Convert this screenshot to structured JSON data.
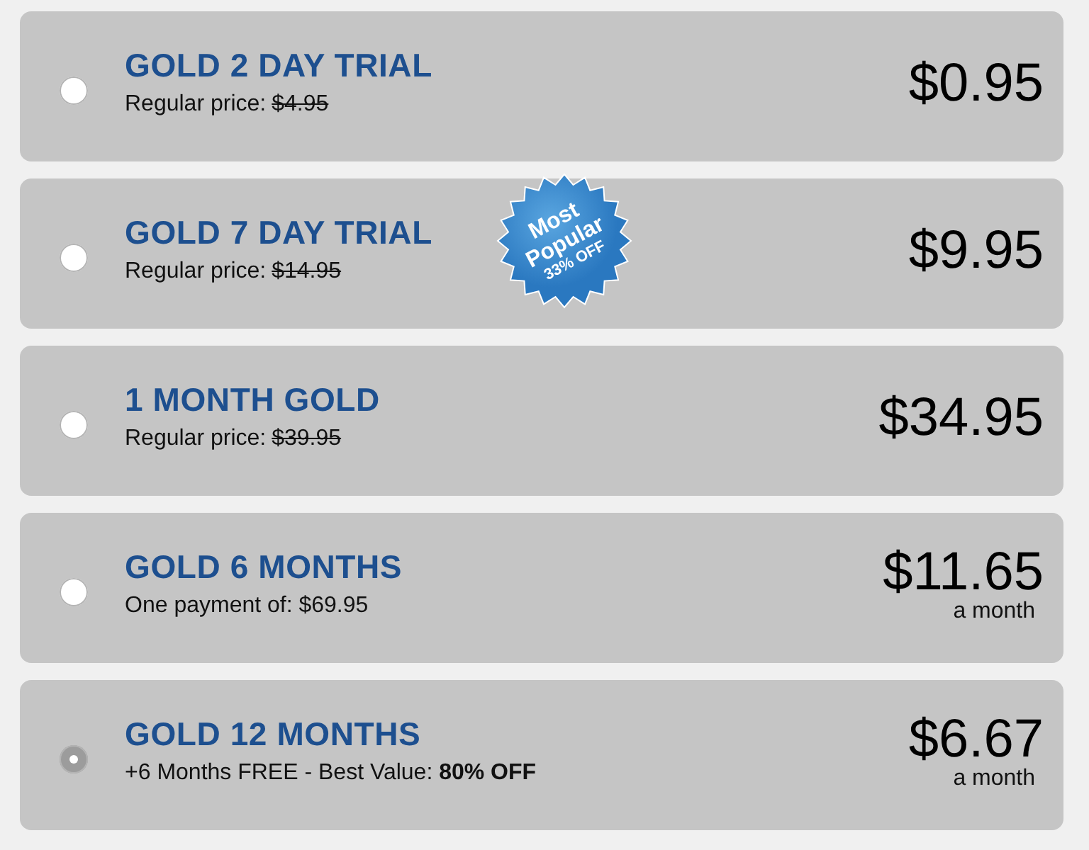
{
  "plans": [
    {
      "title": "GOLD 2 DAY TRIAL",
      "kind": "regular",
      "price_label": "Regular price:",
      "old_price": "$4.95",
      "price": "$0.95",
      "selected": false
    },
    {
      "title": "GOLD 7 DAY TRIAL",
      "kind": "regular",
      "price_label": "Regular price:",
      "old_price": "$14.95",
      "price": "$9.95",
      "selected": false,
      "badge": [
        "Most",
        "Popular",
        "33% OFF"
      ]
    },
    {
      "title": "1 MONTH GOLD",
      "kind": "regular",
      "price_label": "Regular price:",
      "old_price": "$39.95",
      "price": "$34.95",
      "selected": false
    },
    {
      "title": "GOLD 6 MONTHS",
      "kind": "note",
      "note": "One payment of: $69.95",
      "price": "$11.65",
      "period": "a month",
      "selected": false
    },
    {
      "title": "GOLD 12 MONTHS",
      "kind": "note",
      "note": "+6 Months FREE - Best Value: **80% OFF**",
      "price": "$6.67",
      "period": "a month",
      "selected": true
    }
  ]
}
